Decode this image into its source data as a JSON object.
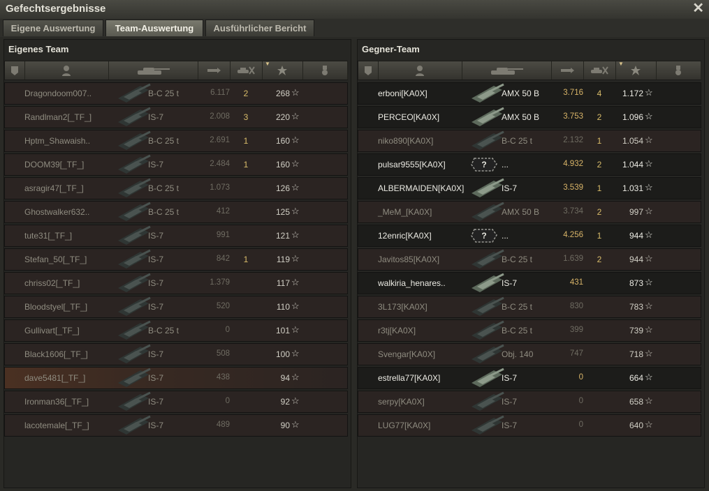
{
  "window": {
    "title": "Gefechtsergebnisse"
  },
  "tabs": [
    {
      "label": "Eigene Auswertung"
    },
    {
      "label": "Team-Auswertung"
    },
    {
      "label": "Ausführlicher Bericht"
    }
  ],
  "active_tab": 1,
  "header_icons": [
    "platoon-icon",
    "player-icon",
    "vehicle-icon",
    "damage-icon",
    "kills-icon",
    "xp-star-icon",
    "medal-icon"
  ],
  "colors": {
    "alive_text": "#ecebe4",
    "dead_text": "#8f8c80",
    "kills": "#d8bc6a",
    "alive_damage": "#d8b468",
    "own_player_highlight": "#4a3022"
  },
  "own_team": {
    "title": "Eigenes Team",
    "rows": [
      {
        "name": "Dragondoom007..",
        "vehicle": "B-C 25 t",
        "damage": "6.117",
        "kills": "2",
        "xp": "268",
        "alive": false,
        "tank": "medium"
      },
      {
        "name": "Randlman2[_TF_]",
        "vehicle": "IS-7",
        "damage": "2.008",
        "kills": "3",
        "xp": "220",
        "alive": false,
        "tank": "heavy"
      },
      {
        "name": "Hptm_Shawaish..",
        "vehicle": "B-C 25 t",
        "damage": "2.691",
        "kills": "1",
        "xp": "160",
        "alive": false,
        "tank": "medium"
      },
      {
        "name": "DOOM39[_TF_]",
        "vehicle": "IS-7",
        "damage": "2.484",
        "kills": "1",
        "xp": "160",
        "alive": false,
        "tank": "heavy"
      },
      {
        "name": "asragir47[_TF_]",
        "vehicle": "B-C 25 t",
        "damage": "1.073",
        "kills": "",
        "xp": "126",
        "alive": false,
        "tank": "medium"
      },
      {
        "name": "Ghostwalker632..",
        "vehicle": "B-C 25 t",
        "damage": "412",
        "kills": "",
        "xp": "125",
        "alive": false,
        "tank": "medium"
      },
      {
        "name": "tute31[_TF_]",
        "vehicle": "IS-7",
        "damage": "991",
        "kills": "",
        "xp": "121",
        "alive": false,
        "tank": "heavy"
      },
      {
        "name": "Stefan_50[_TF_]",
        "vehicle": "IS-7",
        "damage": "842",
        "kills": "1",
        "xp": "119",
        "alive": false,
        "tank": "heavy"
      },
      {
        "name": "chriss02[_TF_]",
        "vehicle": "IS-7",
        "damage": "1.379",
        "kills": "",
        "xp": "117",
        "alive": false,
        "tank": "heavy"
      },
      {
        "name": "Bloodstyel[_TF_]",
        "vehicle": "IS-7",
        "damage": "520",
        "kills": "",
        "xp": "110",
        "alive": false,
        "tank": "heavy"
      },
      {
        "name": "Gullivart[_TF_]",
        "vehicle": "B-C 25 t",
        "damage": "0",
        "kills": "",
        "xp": "101",
        "alive": false,
        "tank": "medium"
      },
      {
        "name": "Black1606[_TF_]",
        "vehicle": "IS-7",
        "damage": "508",
        "kills": "",
        "xp": "100",
        "alive": false,
        "tank": "heavy"
      },
      {
        "name": "dave5481[_TF_]",
        "vehicle": "IS-7",
        "damage": "438",
        "kills": "",
        "xp": "94",
        "alive": false,
        "tank": "heavy",
        "me": true
      },
      {
        "name": "Ironman36[_TF_]",
        "vehicle": "IS-7",
        "damage": "0",
        "kills": "",
        "xp": "92",
        "alive": false,
        "tank": "heavy"
      },
      {
        "name": "lacotemale[_TF_]",
        "vehicle": "IS-7",
        "damage": "489",
        "kills": "",
        "xp": "90",
        "alive": false,
        "tank": "heavy"
      }
    ]
  },
  "enemy_team": {
    "title": "Gegner-Team",
    "rows": [
      {
        "name": "erboni[KA0X]",
        "vehicle": "AMX 50 B",
        "damage": "3.716",
        "kills": "4",
        "xp": "1.172",
        "alive": true,
        "tank": "amx"
      },
      {
        "name": "PERCEO[KA0X]",
        "vehicle": "AMX 50 B",
        "damage": "3.753",
        "kills": "2",
        "xp": "1.096",
        "alive": true,
        "tank": "amx"
      },
      {
        "name": "niko890[KA0X]",
        "vehicle": "B-C 25 t",
        "damage": "2.132",
        "kills": "1",
        "xp": "1.054",
        "alive": false,
        "tank": "medium"
      },
      {
        "name": "pulsar9555[KA0X]",
        "vehicle": "...",
        "damage": "4.932",
        "kills": "2",
        "xp": "1.044",
        "alive": true,
        "tank": "unknown"
      },
      {
        "name": "ALBERMAIDEN[KA0X]",
        "vehicle": "IS-7",
        "damage": "3.539",
        "kills": "1",
        "xp": "1.031",
        "alive": true,
        "tank": "heavy"
      },
      {
        "name": "_MeM_[KA0X]",
        "vehicle": "AMX 50 B",
        "damage": "3.734",
        "kills": "2",
        "xp": "997",
        "alive": false,
        "tank": "amx"
      },
      {
        "name": "12enric[KA0X]",
        "vehicle": "...",
        "damage": "4.256",
        "kills": "1",
        "xp": "944",
        "alive": true,
        "tank": "unknown"
      },
      {
        "name": "Javitos85[KA0X]",
        "vehicle": "B-C 25 t",
        "damage": "1.639",
        "kills": "2",
        "xp": "944",
        "alive": false,
        "tank": "medium"
      },
      {
        "name": "walkiria_henares..",
        "vehicle": "IS-7",
        "damage": "431",
        "kills": "",
        "xp": "873",
        "alive": true,
        "tank": "heavy"
      },
      {
        "name": "3L173[KA0X]",
        "vehicle": "B-C 25 t",
        "damage": "830",
        "kills": "",
        "xp": "783",
        "alive": false,
        "tank": "medium"
      },
      {
        "name": "r3tj[KA0X]",
        "vehicle": "B-C 25 t",
        "damage": "399",
        "kills": "",
        "xp": "739",
        "alive": false,
        "tank": "medium"
      },
      {
        "name": "Svengar[KA0X]",
        "vehicle": "Obj. 140",
        "damage": "747",
        "kills": "",
        "xp": "718",
        "alive": false,
        "tank": "medium"
      },
      {
        "name": "estrella77[KA0X]",
        "vehicle": "IS-7",
        "damage": "0",
        "kills": "",
        "xp": "664",
        "alive": true,
        "tank": "heavy"
      },
      {
        "name": "serpy[KA0X]",
        "vehicle": "IS-7",
        "damage": "0",
        "kills": "",
        "xp": "658",
        "alive": false,
        "tank": "heavy"
      },
      {
        "name": "LUG77[KA0X]",
        "vehicle": "IS-7",
        "damage": "0",
        "kills": "",
        "xp": "640",
        "alive": false,
        "tank": "heavy"
      }
    ]
  }
}
